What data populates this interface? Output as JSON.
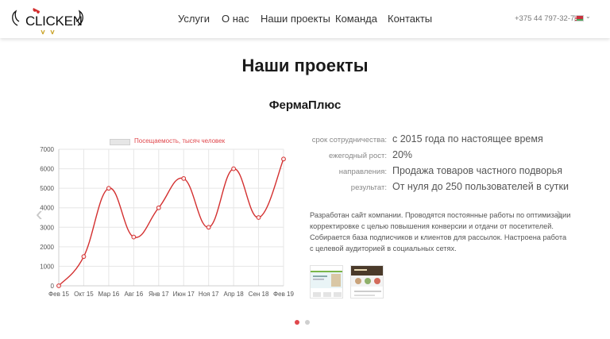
{
  "header": {
    "logo_text": "CLICKEN",
    "nav": [
      "Услуги",
      "О нас",
      "Наши проекты",
      "Команда",
      "Контакты"
    ],
    "phone": "+375 44 797-32-76",
    "lang_caret": "⌄"
  },
  "section_title": "Наши проекты",
  "project": {
    "title": "ФермаПлюс",
    "details": [
      {
        "label": "срок сотрудничества:",
        "value": "с 2015 года по настоящее время"
      },
      {
        "label": "ежегодный рост:",
        "value": "20%"
      },
      {
        "label": "направления:",
        "value": "Продажа товаров частного подворья"
      },
      {
        "label": "результат:",
        "value": "От нуля до 250 пользователей в сутки"
      }
    ],
    "description": "Разработан сайт компании. Проводятся постоянные работы по оптимизации корректировке с целью повышения конверсии и отдачи от посетителей. Собирается база подписчиков и клиентов для рассылок. Настроена работа с целевой аудиторией в социальных сетях.",
    "thumbnails": [
      "thumb-1",
      "thumb-2"
    ]
  },
  "carousel": {
    "prev_icon": "‹",
    "next_icon": "›",
    "active_index": 0,
    "slide_count": 2
  },
  "colors": {
    "accent": "#e0474c",
    "line": "#d32f2f"
  },
  "chart_data": {
    "type": "line",
    "categories": [
      "Фев 15",
      "Окт 15",
      "Мар 16",
      "Авг 16",
      "Янв 17",
      "Июн 17",
      "Ноя 17",
      "Апр 18",
      "Сен 18",
      "Фев 19"
    ],
    "series": [
      {
        "name": "Посещаемость, тысяч человек",
        "values": [
          0,
          1500,
          5000,
          2500,
          4000,
          5500,
          3000,
          6000,
          3500,
          6500
        ]
      }
    ],
    "ylim": [
      0,
      7000
    ],
    "yticks": [
      0,
      1000,
      2000,
      3000,
      4000,
      5000,
      6000,
      7000
    ],
    "grid": true,
    "legend": "top"
  }
}
